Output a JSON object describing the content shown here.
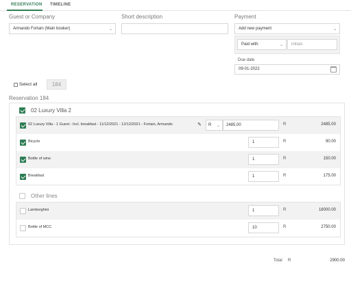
{
  "tabs": [
    {
      "label": "RESERVATION",
      "active": true
    },
    {
      "label": "TIMELINE",
      "active": false
    }
  ],
  "form": {
    "guest_label": "Guest or Company",
    "guest_value": "Armando Fortain (Main booker)",
    "short_desc_label": "Short description",
    "short_desc_value": "",
    "payment_label": "Payment",
    "payment_select": "Add new payment",
    "paid_with": "Paid with:",
    "initials_placeholder": "initials",
    "due_date_label": "Due date",
    "due_date_value": "09-01-2022"
  },
  "select_all_label": "Select all",
  "select_all_count": "184",
  "reservation_title": "Reservation 184",
  "groups": [
    {
      "title": "02 Luxury Villa 2",
      "checked": true,
      "rows": [
        {
          "text": "02 Luxury Villa - 1 Guest - Incl. breakfast - 11/12/2021 - 12/12/2021 - Fortain, Armando",
          "currency_select": "R",
          "qty": "2485.00",
          "currency": "R",
          "amount": "2485.00",
          "checked": true
        },
        {
          "text": "Bicycle",
          "qty": "1",
          "currency": "R",
          "amount": "90.00",
          "checked": true
        },
        {
          "text": "Bottle of wine",
          "qty": "1",
          "currency": "R",
          "amount": "150.00",
          "checked": true
        },
        {
          "text": "Breakfast",
          "qty": "1",
          "currency": "R",
          "amount": "175.00",
          "checked": true
        }
      ]
    },
    {
      "title": "Other lines",
      "checked": false,
      "rows": [
        {
          "text": "Lamborghini",
          "qty": "1",
          "currency": "R",
          "amount": "18000.00",
          "checked": false
        },
        {
          "text": "Bottle of MCC",
          "qty": "10",
          "currency": "R",
          "amount": "2750.00",
          "checked": false
        }
      ]
    }
  ],
  "total": {
    "label": "Total",
    "currency": "R",
    "amount": "2900.00"
  },
  "colors": {
    "accent": "#2e7d55"
  },
  "icons": {
    "pencil": "pencil-icon",
    "calendar": "calendar-icon",
    "dropdown": "chevron-down-icon"
  }
}
